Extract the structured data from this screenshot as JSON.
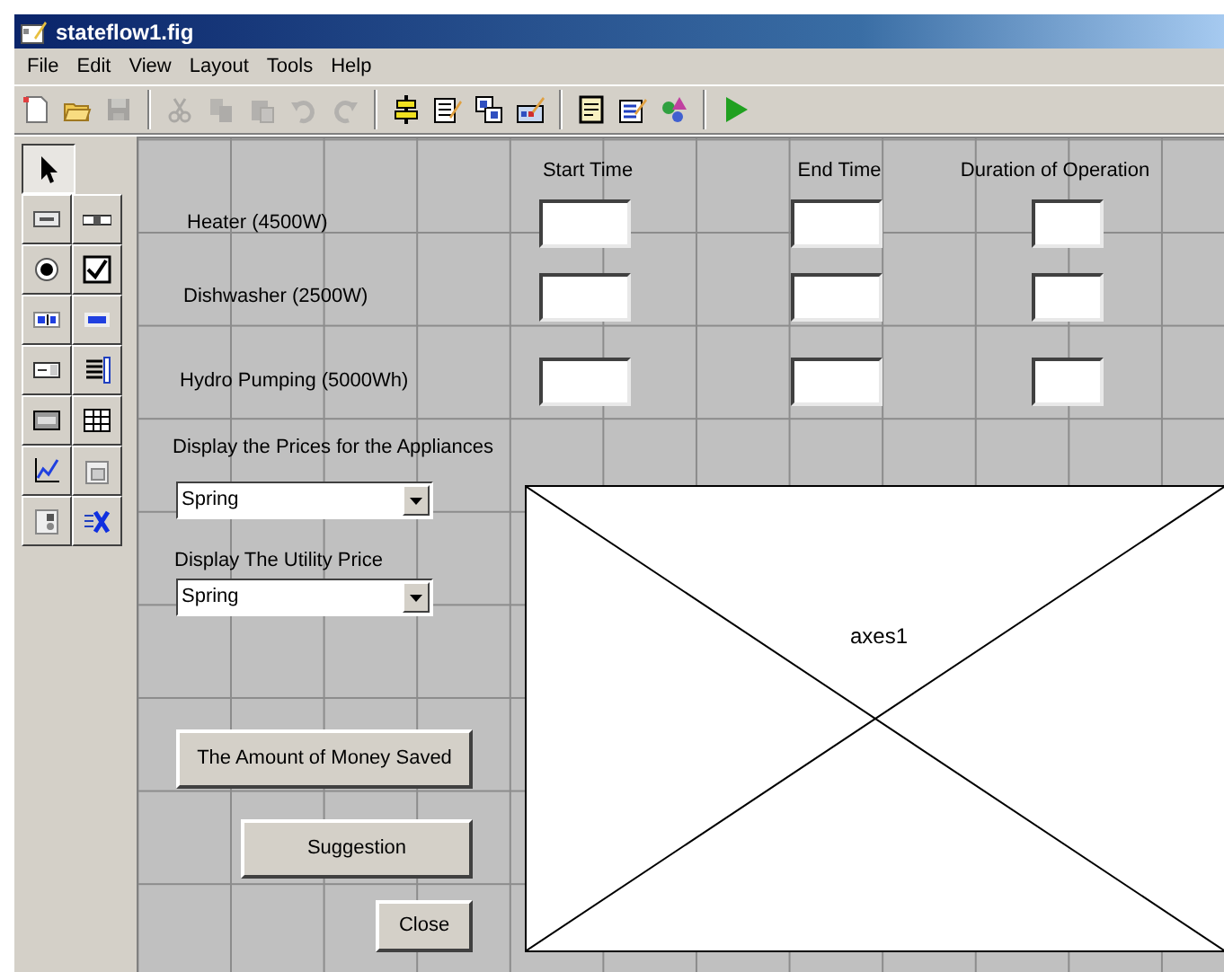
{
  "window": {
    "title": "stateflow1.fig"
  },
  "menu": [
    "File",
    "Edit",
    "View",
    "Layout",
    "Tools",
    "Help"
  ],
  "toolbar": [
    {
      "kind": "new",
      "disabled": false
    },
    {
      "kind": "open",
      "disabled": false
    },
    {
      "kind": "save",
      "disabled": true
    },
    {
      "kind": "sep"
    },
    {
      "kind": "cut",
      "disabled": true
    },
    {
      "kind": "copy",
      "disabled": true
    },
    {
      "kind": "paste",
      "disabled": true
    },
    {
      "kind": "undo",
      "disabled": true
    },
    {
      "kind": "redo",
      "disabled": true
    },
    {
      "kind": "sep"
    },
    {
      "kind": "align",
      "disabled": false
    },
    {
      "kind": "menu-editor",
      "disabled": false
    },
    {
      "kind": "tab-order",
      "disabled": false
    },
    {
      "kind": "toolbar-editor",
      "disabled": false
    },
    {
      "kind": "sep"
    },
    {
      "kind": "editor",
      "disabled": false
    },
    {
      "kind": "inspector",
      "disabled": false
    },
    {
      "kind": "browser",
      "disabled": false
    },
    {
      "kind": "sep"
    },
    {
      "kind": "run",
      "disabled": false
    }
  ],
  "palette": [
    {
      "kind": "select",
      "selected": true
    },
    {
      "kind": "pushbutton",
      "selected": false
    },
    {
      "kind": "slider",
      "selected": false
    },
    {
      "kind": "radio",
      "selected": false
    },
    {
      "kind": "checkbox",
      "selected": false
    },
    {
      "kind": "edit",
      "selected": false
    },
    {
      "kind": "text",
      "selected": false
    },
    {
      "kind": "popup",
      "selected": false
    },
    {
      "kind": "listbox",
      "selected": false
    },
    {
      "kind": "toggle",
      "selected": false
    },
    {
      "kind": "table",
      "selected": false
    },
    {
      "kind": "axes",
      "selected": false
    },
    {
      "kind": "panel",
      "selected": false
    },
    {
      "kind": "buttongroup",
      "selected": false
    },
    {
      "kind": "activex",
      "selected": false
    }
  ],
  "canvas": {
    "column_headers": [
      "Start Time",
      "End Time",
      "Duration of Operation"
    ],
    "appliances": [
      {
        "label": "Heater (4500W)"
      },
      {
        "label": "Dishwasher (2500W)"
      },
      {
        "label": "Hydro Pumping (5000Wh)"
      }
    ],
    "price_label": "Display the Prices for the Appliances",
    "price_popup": {
      "value": "Spring"
    },
    "utility_label": "Display The Utility Price",
    "utility_popup": {
      "value": "Spring"
    },
    "buttons": [
      "The Amount of Money Saved",
      "Suggestion",
      "Close"
    ],
    "axes": {
      "label": "axes1"
    }
  }
}
